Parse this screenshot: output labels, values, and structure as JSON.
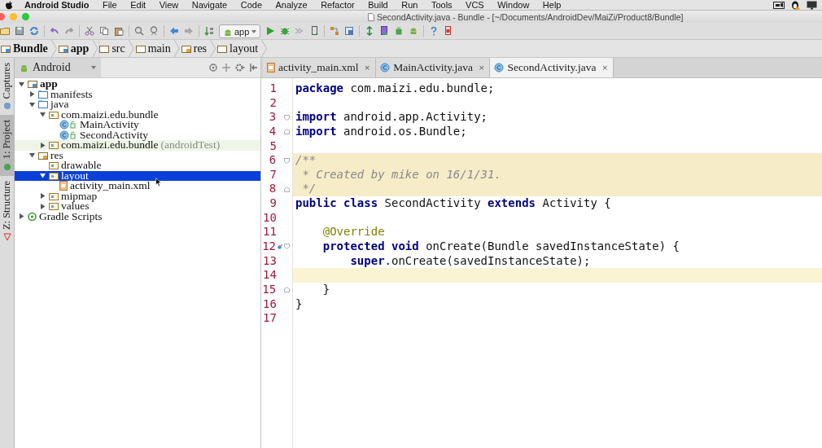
{
  "menu_bar": {
    "app_name": "Android Studio",
    "items": [
      "File",
      "Edit",
      "View",
      "Navigate",
      "Code",
      "Analyze",
      "Refactor",
      "Build",
      "Run",
      "Tools",
      "VCS",
      "Window",
      "Help"
    ]
  },
  "window": {
    "title": "SecondActivity.java - Bundle - [~/Documents/AndroidDev/MaiZi/Product8/Bundle]"
  },
  "toolbar": {
    "run_config": "app"
  },
  "breadcrumbs": [
    {
      "label": "Bundle",
      "kind": "module"
    },
    {
      "label": "app",
      "kind": "module"
    },
    {
      "label": "src",
      "kind": "folder"
    },
    {
      "label": "main",
      "kind": "folder"
    },
    {
      "label": "res",
      "kind": "resources"
    },
    {
      "label": "layout",
      "kind": "folder"
    }
  ],
  "tool_strip": [
    {
      "label": "Captures",
      "selected": false
    },
    {
      "label": "1: Project",
      "selected": true
    },
    {
      "label": "Z: Structure",
      "selected": false
    }
  ],
  "project_panel": {
    "view": "Android",
    "tree": [
      {
        "label": "app",
        "kind": "module",
        "expanded": true,
        "selected": false,
        "children": [
          {
            "label": "manifests",
            "kind": "source",
            "expanded": false,
            "selected": false
          },
          {
            "label": "java",
            "kind": "source",
            "expanded": true,
            "selected": false,
            "children": [
              {
                "label": "com.maizi.edu.bundle",
                "kind": "package",
                "expanded": true,
                "selected": false,
                "children": [
                  {
                    "label": "MainActivity",
                    "kind": "class",
                    "selected": false
                  },
                  {
                    "label": "SecondActivity",
                    "kind": "class",
                    "selected": false
                  }
                ]
              },
              {
                "label": "com.maizi.edu.bundle",
                "suffix": "(androidTest)",
                "kind": "test_package",
                "expanded": false,
                "selected": false
              }
            ]
          },
          {
            "label": "res",
            "kind": "resources",
            "expanded": true,
            "selected": false,
            "children": [
              {
                "label": "drawable",
                "kind": "package",
                "selected": false
              },
              {
                "label": "layout",
                "kind": "package",
                "expanded": true,
                "selected": true,
                "children": [
                  {
                    "label": "activity_main.xml",
                    "kind": "xml",
                    "selected": false
                  }
                ]
              },
              {
                "label": "mipmap",
                "kind": "package",
                "expanded": false,
                "selected": false
              },
              {
                "label": "values",
                "kind": "package",
                "expanded": false,
                "selected": false
              }
            ]
          }
        ]
      },
      {
        "label": "Gradle Scripts",
        "kind": "gradle",
        "expanded": false,
        "selected": false
      }
    ]
  },
  "editor": {
    "tabs": [
      {
        "label": "activity_main.xml",
        "kind": "xml",
        "selected": false,
        "close": "×"
      },
      {
        "label": "MainActivity.java",
        "kind": "class",
        "selected": false,
        "close": "×"
      },
      {
        "label": "SecondActivity.java",
        "kind": "class",
        "selected": true,
        "close": "×"
      }
    ],
    "lines": [
      {
        "number": "1",
        "highlighted": false,
        "current": false,
        "fold_start": false,
        "fold_end": false,
        "override_marker": false,
        "tokens": [
          {
            "text": "package",
            "kind": "keyword"
          },
          {
            "text": " com.maizi.edu.bundle;",
            "kind": "plain"
          }
        ]
      },
      {
        "number": "2",
        "highlighted": false,
        "current": false,
        "fold_start": false,
        "fold_end": false,
        "override_marker": false
      },
      {
        "number": "3",
        "highlighted": false,
        "current": false,
        "fold_start": true,
        "fold_end": false,
        "override_marker": false,
        "tokens": [
          {
            "text": "import",
            "kind": "keyword"
          },
          {
            "text": " android.app.Activity;",
            "kind": "plain"
          }
        ]
      },
      {
        "number": "4",
        "highlighted": false,
        "current": false,
        "fold_start": false,
        "fold_end": true,
        "override_marker": false,
        "tokens": [
          {
            "text": "import",
            "kind": "keyword"
          },
          {
            "text": " android.os.Bundle;",
            "kind": "plain"
          }
        ]
      },
      {
        "number": "5",
        "highlighted": false,
        "current": false,
        "fold_start": false,
        "fold_end": false,
        "override_marker": false
      },
      {
        "number": "6",
        "highlighted": true,
        "current": false,
        "fold_start": true,
        "fold_end": false,
        "override_marker": false,
        "tokens": [
          {
            "text": "/**",
            "kind": "comment"
          }
        ]
      },
      {
        "number": "7",
        "highlighted": true,
        "current": false,
        "fold_start": false,
        "fold_end": false,
        "override_marker": false,
        "tokens": [
          {
            "text": " * Created by mike on 16/1/31.",
            "kind": "comment"
          }
        ]
      },
      {
        "number": "8",
        "highlighted": true,
        "current": false,
        "fold_start": false,
        "fold_end": true,
        "override_marker": false,
        "tokens": [
          {
            "text": " */",
            "kind": "comment"
          }
        ]
      },
      {
        "number": "9",
        "highlighted": false,
        "current": false,
        "fold_start": false,
        "fold_end": false,
        "override_marker": false,
        "tokens": [
          {
            "text": "public class",
            "kind": "keyword"
          },
          {
            "text": " SecondActivity ",
            "kind": "plain"
          },
          {
            "text": "extends",
            "kind": "keyword"
          },
          {
            "text": " Activity {",
            "kind": "plain"
          }
        ]
      },
      {
        "number": "10",
        "highlighted": false,
        "current": false,
        "fold_start": false,
        "fold_end": false,
        "override_marker": false
      },
      {
        "number": "11",
        "highlighted": false,
        "current": false,
        "fold_start": false,
        "fold_end": false,
        "override_marker": false,
        "tokens": [
          {
            "text": "    @Override",
            "kind": "annotation"
          }
        ]
      },
      {
        "number": "12",
        "highlighted": false,
        "current": false,
        "fold_start": true,
        "fold_end": false,
        "override_marker": true,
        "tokens": [
          {
            "text": "    protected void",
            "kind": "keyword"
          },
          {
            "text": " onCreate(Bundle savedInstanceState) {",
            "kind": "plain"
          }
        ]
      },
      {
        "number": "13",
        "highlighted": false,
        "current": false,
        "fold_start": false,
        "fold_end": false,
        "override_marker": false,
        "tokens": [
          {
            "text": "        super",
            "kind": "keyword"
          },
          {
            "text": ".onCreate(savedInstanceState);",
            "kind": "plain"
          }
        ]
      },
      {
        "number": "14",
        "highlighted": false,
        "current": true,
        "fold_start": false,
        "fold_end": false,
        "override_marker": false
      },
      {
        "number": "15",
        "highlighted": false,
        "current": false,
        "fold_start": false,
        "fold_end": true,
        "override_marker": false,
        "tokens": [
          {
            "text": "    }",
            "kind": "plain"
          }
        ]
      },
      {
        "number": "16",
        "highlighted": false,
        "current": false,
        "fold_start": false,
        "fold_end": false,
        "override_marker": false,
        "tokens": [
          {
            "text": "}",
            "kind": "plain"
          }
        ]
      },
      {
        "number": "17",
        "highlighted": false,
        "current": false,
        "fold_start": false,
        "fold_end": false,
        "override_marker": false
      }
    ]
  }
}
